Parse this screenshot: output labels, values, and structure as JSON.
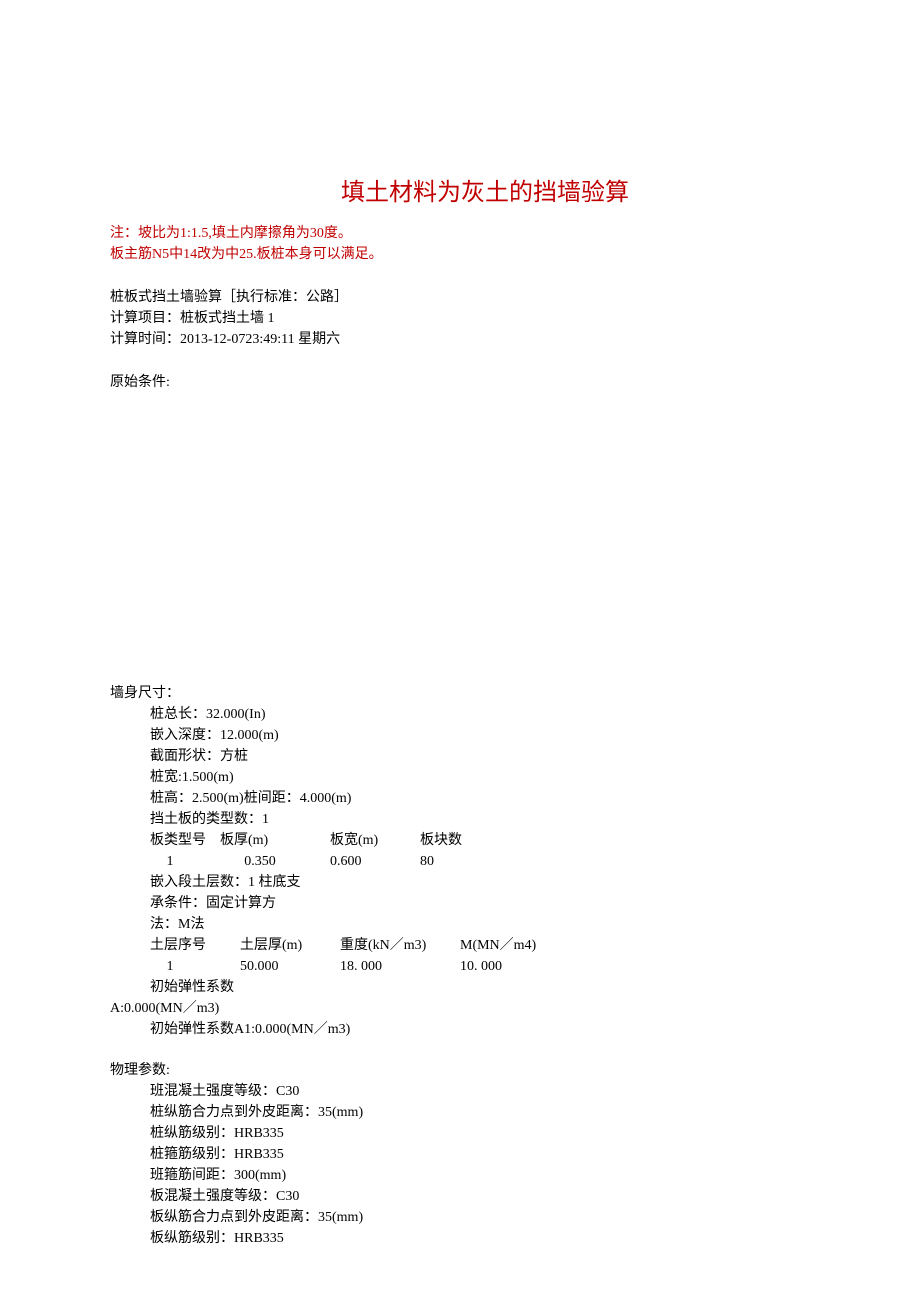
{
  "title": "填土材料为灰土的挡墙验算",
  "notes": {
    "line1": "注：坡比为1:1.5,填土内摩擦角为30度。",
    "line2": "板主筋N5中14改为中25.板桩本身可以满足。"
  },
  "meta": {
    "line1": "桩板式挡土墙验算［执行标准：公路］",
    "line2": "计算项目：桩板式挡土墙 1",
    "line3": "计算时间：2013-12-0723:49:11 星期六"
  },
  "original_conditions_label": "原始条件:",
  "wall_section": {
    "heading": "墙身尺寸：",
    "pile_total_length": "桩总长：32.000(In)",
    "embed_depth": "嵌入深度：12.000(m)",
    "section_shape": "截面形状：方桩",
    "pile_width": "桩宽:1.500(m)",
    "pile_height_spacing": "桩高：2.500(m)桩间距：4.000(m)",
    "board_types": "挡土板的类型数：1",
    "board_header": {
      "c1": "板类型号",
      "c2": "板厚(m)",
      "c3": "板宽(m)",
      "c4": "板块数"
    },
    "board_row": {
      "c1": "1",
      "c2": "0.350",
      "c3": "0.600",
      "c4": "80"
    },
    "embed_layers": "嵌入段土层数：1 柱底支",
    "support_condition": "承条件：固定计算方",
    "method": "法：M法",
    "soil_header": {
      "c1": "土层序号",
      "c2": "土层厚(m)",
      "c3": "重度(kN／m3)",
      "c4": "M(MN／m4)"
    },
    "soil_row": {
      "c1": "1",
      "c2": "50.000",
      "c3": "18. 000",
      "c4": "10. 000"
    },
    "initial_elastic1": "初始弹性系数",
    "initial_elastic1_value": "A:0.000(MN／m3)",
    "initial_elastic2": "初始弹性系数A1:0.000(MN／m3)"
  },
  "physical_section": {
    "heading": "物理参数:",
    "line1": "班混凝土强度等级：C30",
    "line2": "桩纵筋合力点到外皮距离：35(mm)",
    "line3": "桩纵筋级别：HRB335",
    "line4": "桩箍筋级别：HRB335",
    "line5": "班箍筋间距：300(mm)",
    "line6": "板混凝土强度等级：C30",
    "line7": "板纵筋合力点到外皮距离：35(mm)",
    "line8": "板纵筋级别：HRB335"
  }
}
